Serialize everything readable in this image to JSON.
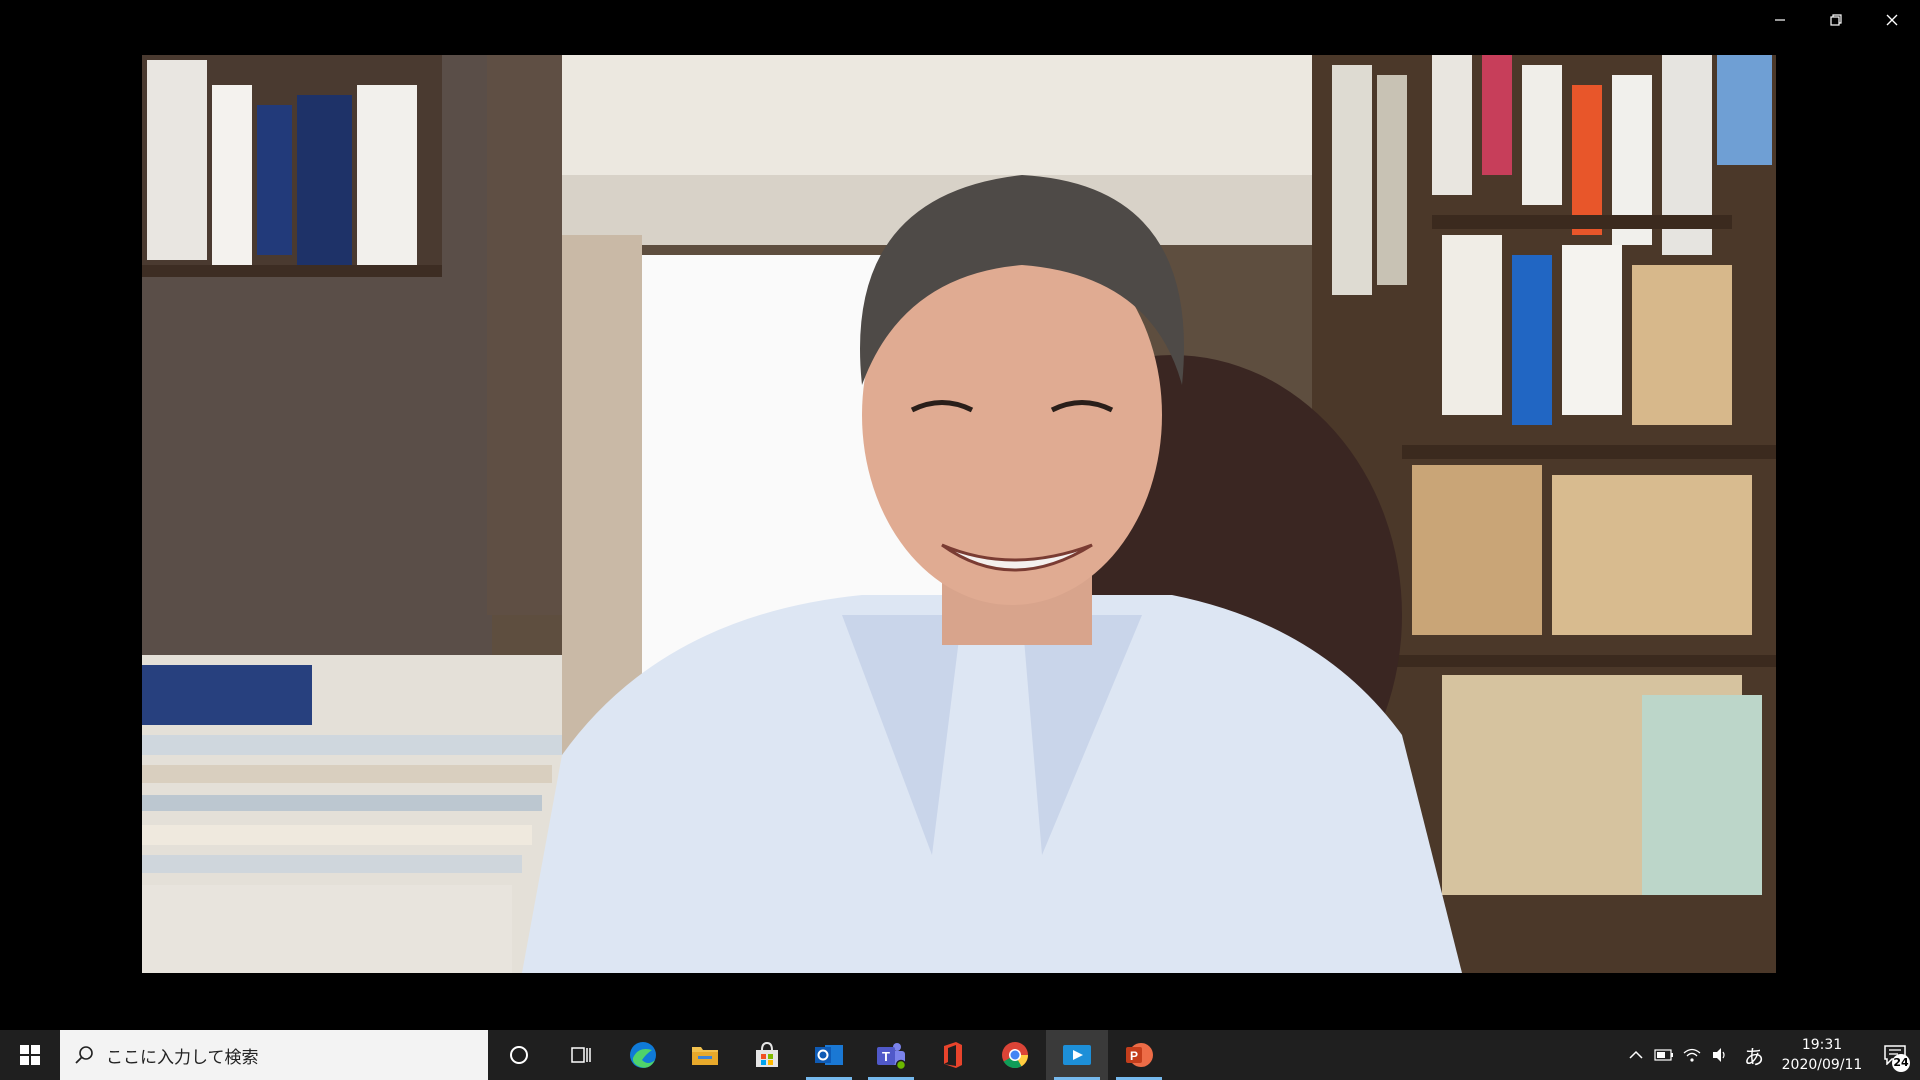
{
  "window": {
    "controls": {
      "minimize": "minimize-icon",
      "restore": "restore-icon",
      "close": "close-icon"
    }
  },
  "video": {
    "content": "webcam video feed"
  },
  "taskbar": {
    "search_placeholder": "ここに入力して検索",
    "apps": [
      {
        "name": "cortana",
        "icon": "cortana-circle-icon"
      },
      {
        "name": "task-view",
        "icon": "task-view-icon"
      },
      {
        "name": "edge",
        "icon": "edge-icon"
      },
      {
        "name": "file-explorer",
        "icon": "folder-icon"
      },
      {
        "name": "store",
        "icon": "store-bag-icon"
      },
      {
        "name": "outlook",
        "icon": "outlook-icon"
      },
      {
        "name": "teams",
        "icon": "teams-icon"
      },
      {
        "name": "office",
        "icon": "office-icon"
      },
      {
        "name": "chrome",
        "icon": "chrome-icon"
      },
      {
        "name": "video-app",
        "icon": "video-play-icon"
      },
      {
        "name": "powerpoint",
        "icon": "powerpoint-icon"
      }
    ],
    "tray": {
      "ime": "あ",
      "time": "19:31",
      "date": "2020/09/11",
      "notification_count": "24"
    }
  },
  "colors": {
    "taskbar_bg": "#1f1f1f",
    "running_indicator": "#76b9ed",
    "search_bg": "#f3f3f3"
  }
}
